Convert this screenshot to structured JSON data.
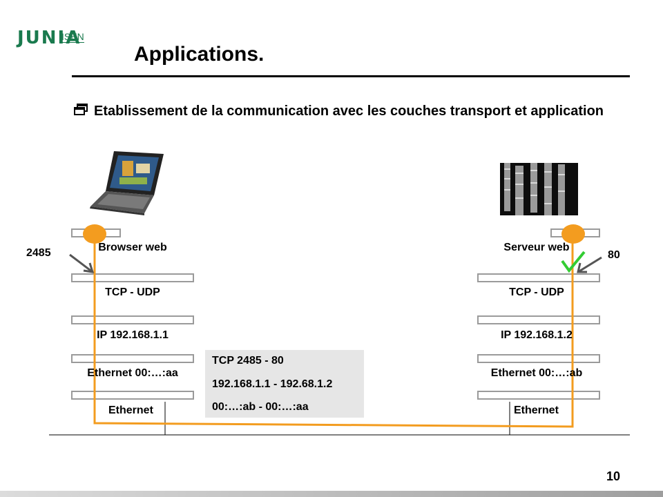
{
  "logo": {
    "brand": "JUNIA",
    "sub": "ISEN"
  },
  "slide": {
    "title": "Applications.",
    "bullet": "Etablissement de la communication avec les couches transport et application",
    "number": "10"
  },
  "client": {
    "port": "2485",
    "app": "Browser web",
    "transport": "TCP - UDP",
    "ip": "IP 192.168.1.1",
    "mac": "Ethernet 00:…:aa",
    "link": "Ethernet"
  },
  "server": {
    "port": "80",
    "app": "Serveur web",
    "transport": "TCP - UDP",
    "ip": "IP 192.168.1.2",
    "mac": "Ethernet 00:…:ab",
    "link": "Ethernet"
  },
  "packet": {
    "tcp": "TCP 2485 - 80",
    "ip": "192.168.1.1 - 192.68.1.2",
    "mac": "00:…:ab - 00:…:aa"
  },
  "colors": {
    "path": "#f39c1f",
    "check": "#33cc33",
    "brand": "#1a7a4e"
  },
  "icons": [
    "laptop-image",
    "server-rack-image",
    "checkmark-icon",
    "pointer-arrow-icon",
    "window-bullet-icon"
  ]
}
